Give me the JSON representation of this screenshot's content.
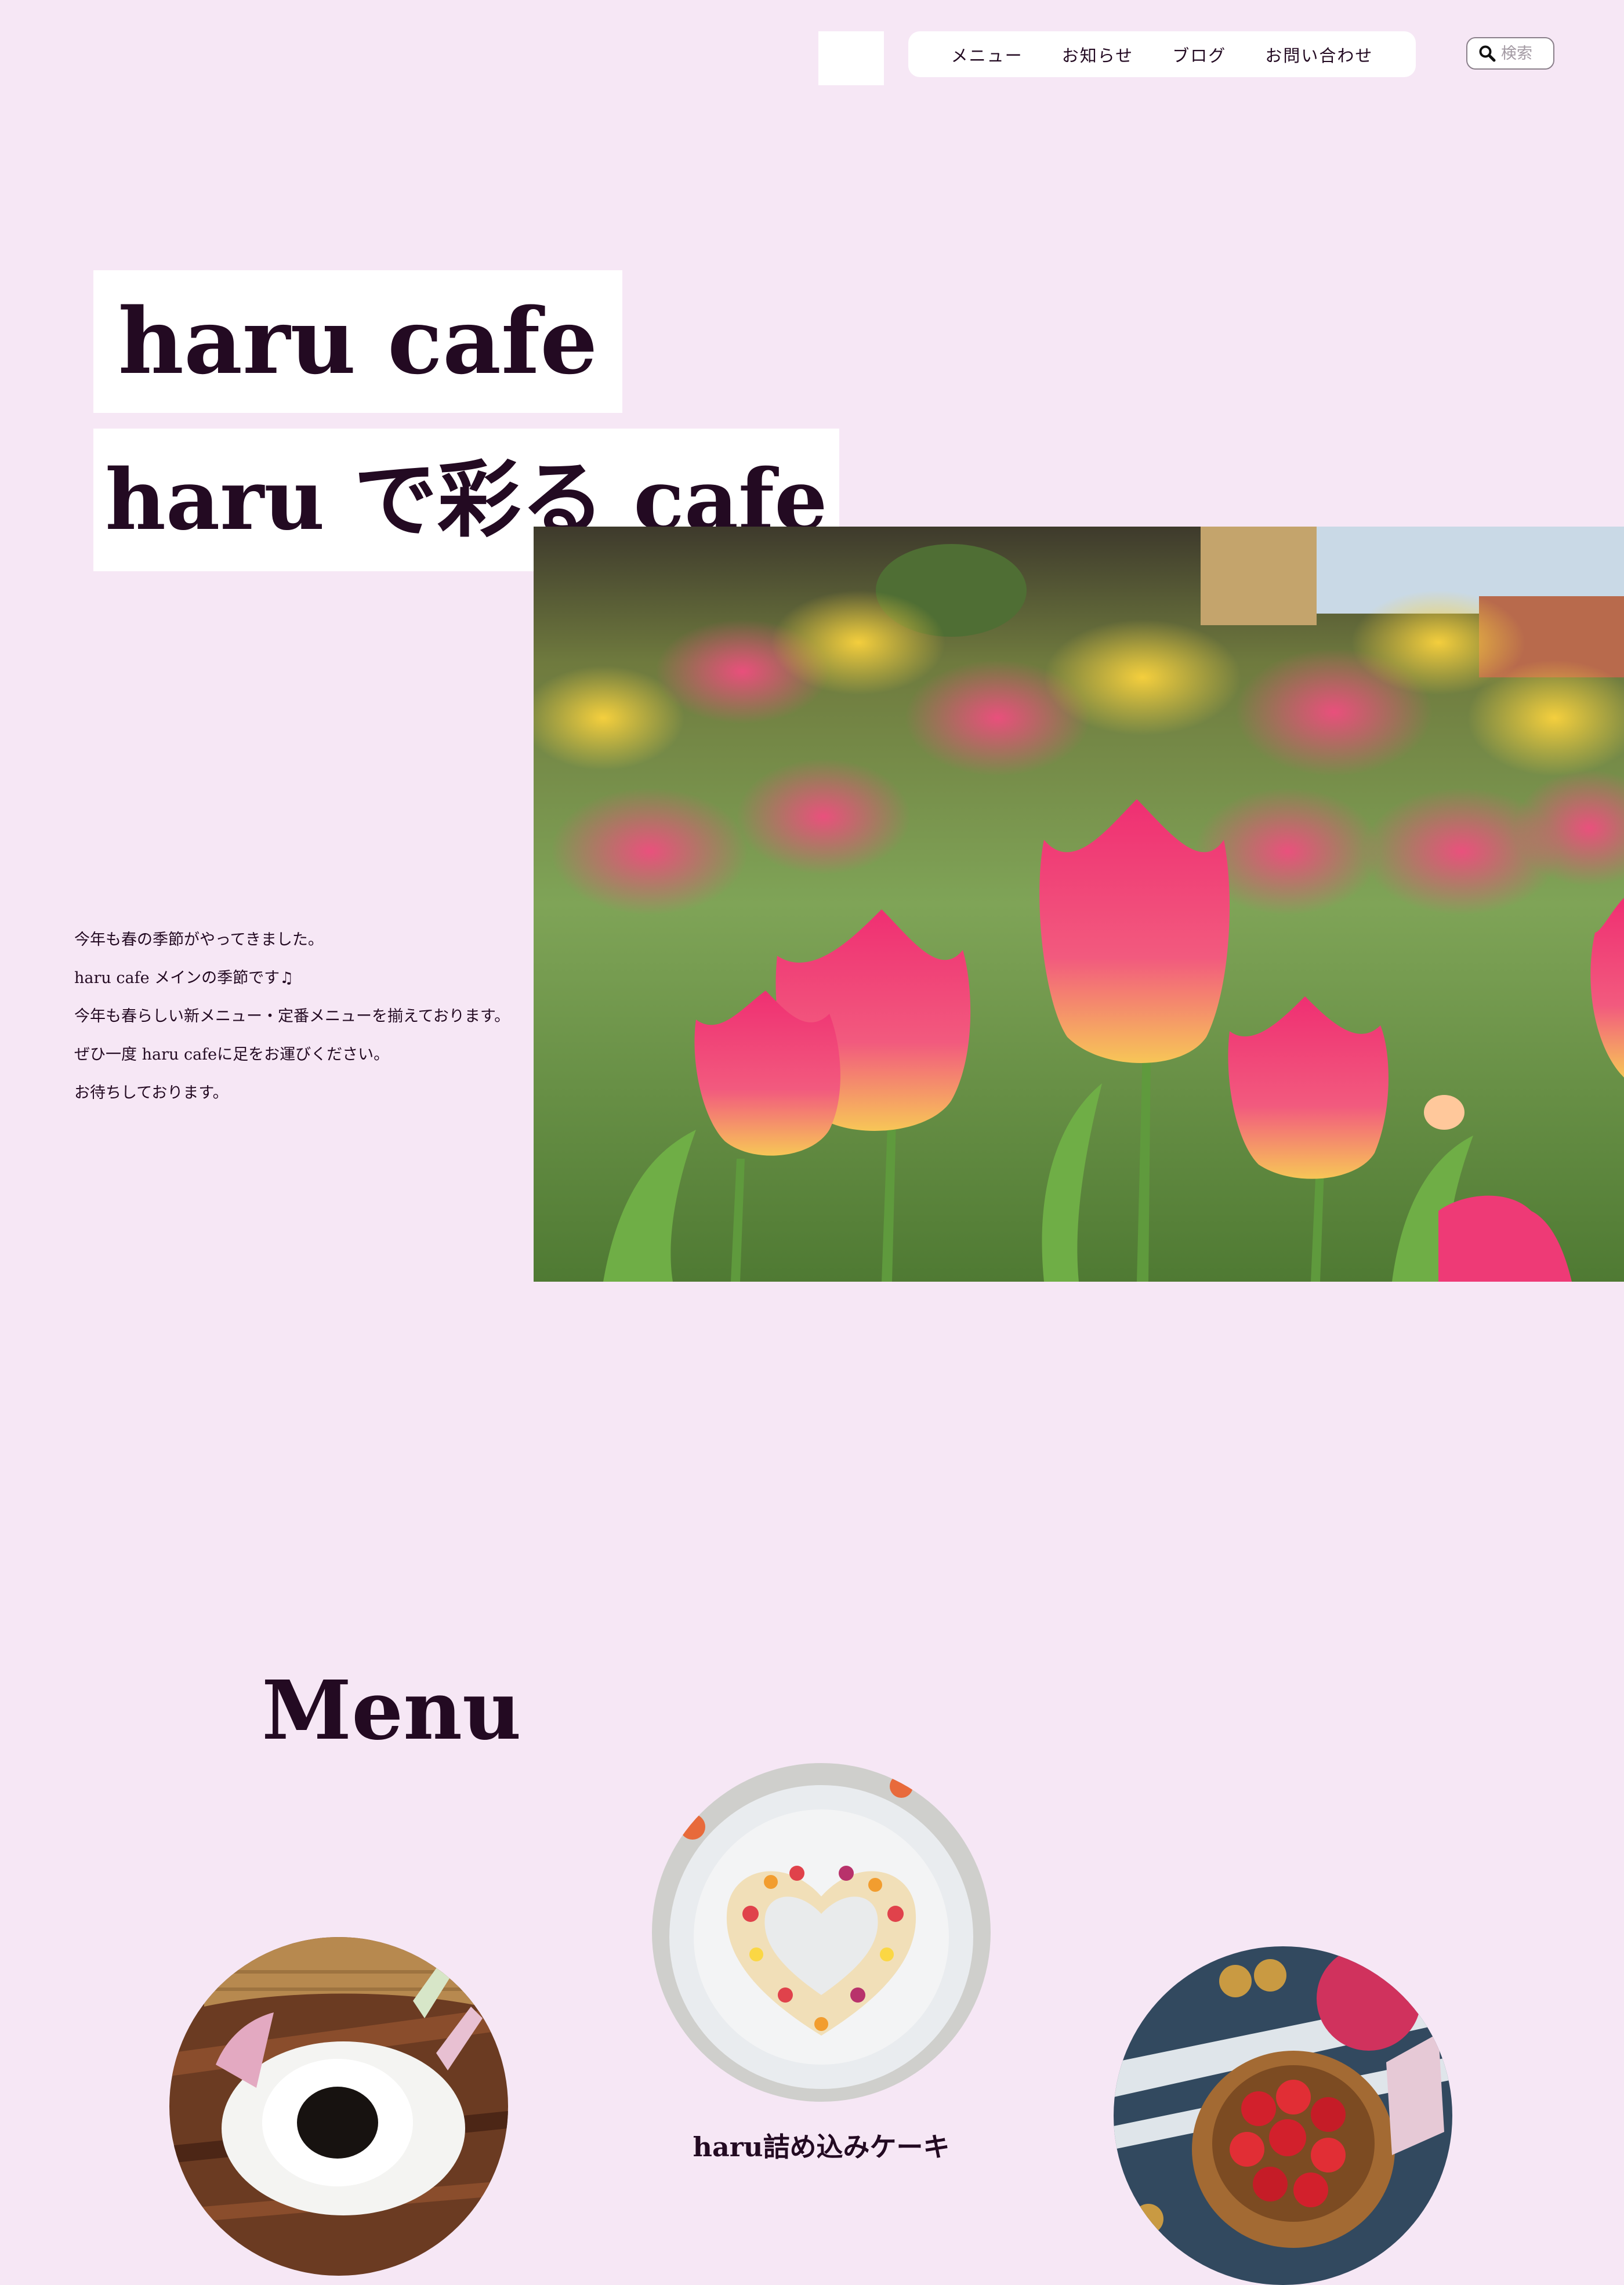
{
  "header": {
    "nav": [
      {
        "label": "メニュー"
      },
      {
        "label": "お知らせ"
      },
      {
        "label": "ブログ"
      },
      {
        "label": "お問い合わせ"
      }
    ],
    "search": {
      "placeholder": "検索",
      "value": ""
    }
  },
  "hero": {
    "title_line1": "haru cafe",
    "title_line2": "haru で彩る cafe",
    "intro_lines": [
      "今年も春の季節がやってきました。",
      "haru cafe メインの季節です♫",
      "今年も春らしい新メニュー・定番メニューを揃えております。",
      "ぜひ一度 haru cafeに足をお運びください。",
      "お待ちしております。"
    ]
  },
  "menu": {
    "heading": "Menu",
    "items": [
      {
        "caption": "haru詰め込みケーキ"
      }
    ]
  },
  "colors": {
    "background": "#f6e7f5",
    "text": "#230a22",
    "panel": "#ffffff"
  }
}
